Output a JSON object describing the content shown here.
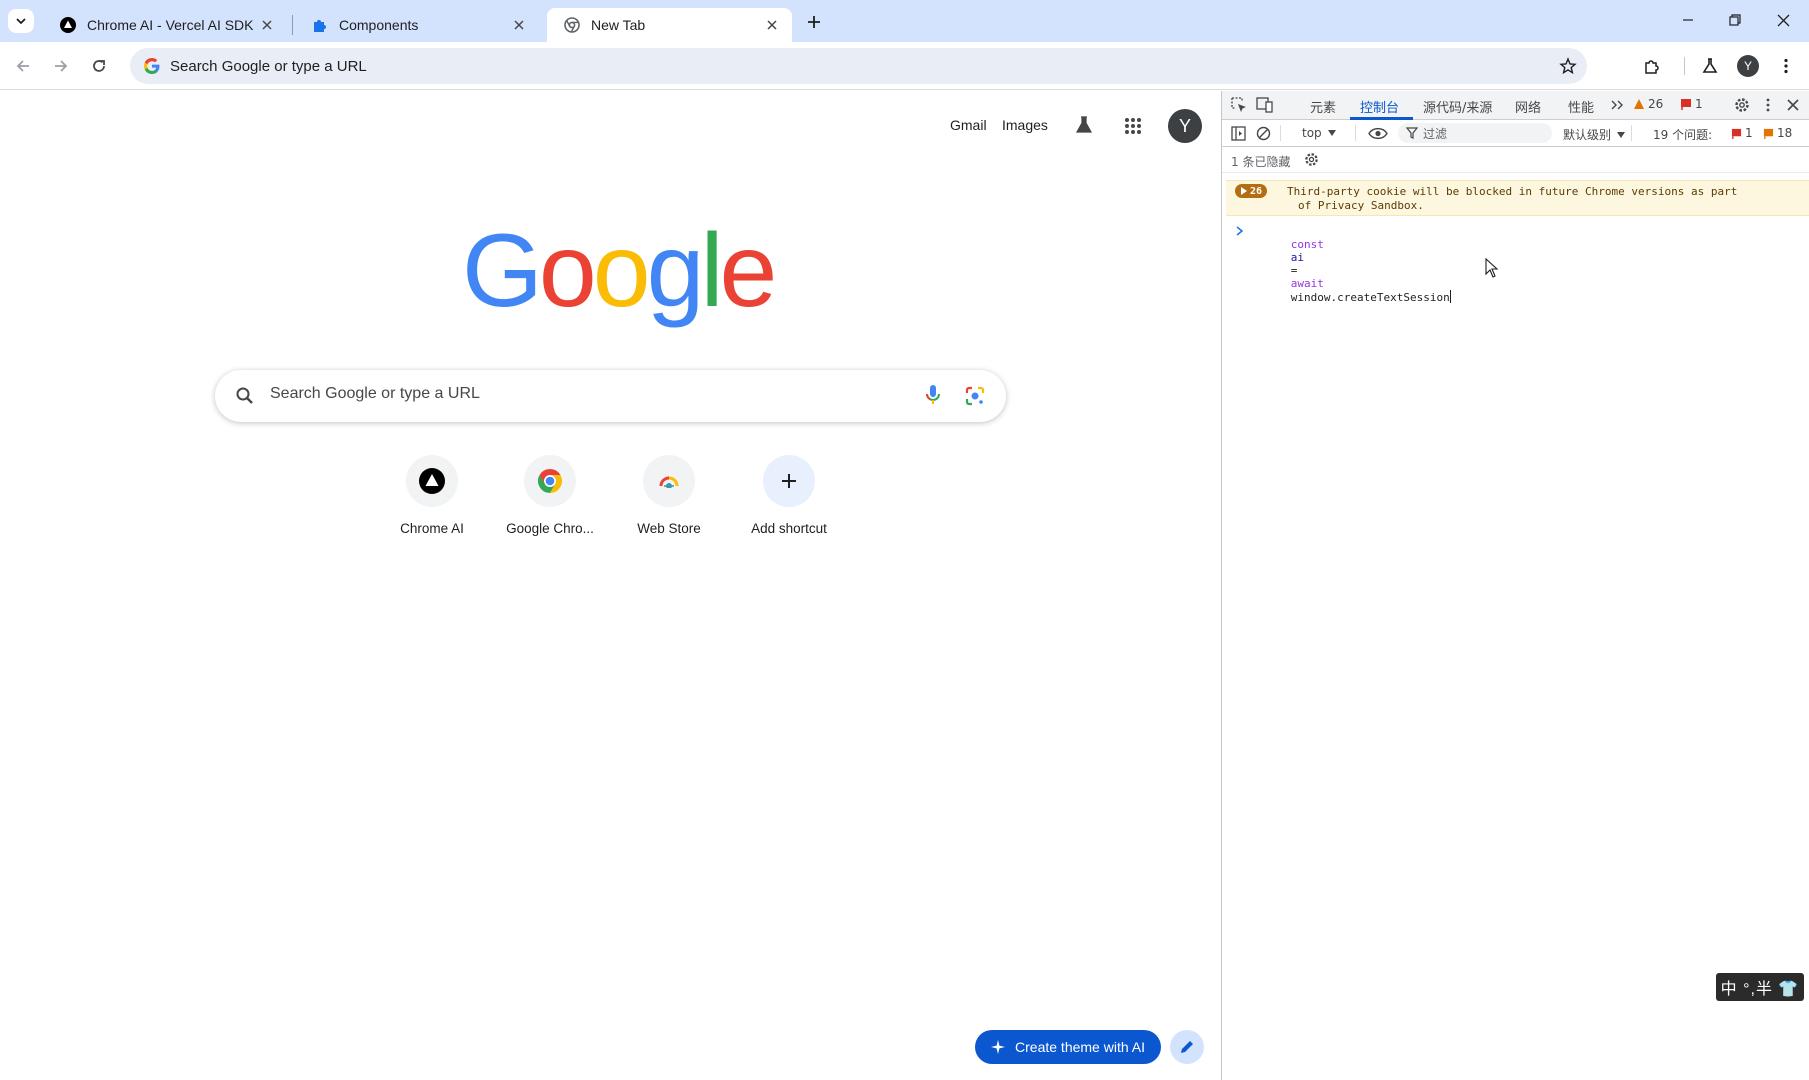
{
  "tabs": [
    {
      "title": "Chrome AI - Vercel AI SDK",
      "icon": "vercel-triangle-icon",
      "active": false
    },
    {
      "title": "Components",
      "icon": "puzzle-piece-icon",
      "active": false
    },
    {
      "title": "New Tab",
      "icon": "chrome-icon",
      "active": true
    }
  ],
  "omnibox": {
    "placeholder": "Search Google or type a URL"
  },
  "toolbar": {
    "profile_initial": "Y"
  },
  "ntp": {
    "links": {
      "gmail": "Gmail",
      "images": "Images"
    },
    "avatar_initial": "Y",
    "logo": "Google",
    "search_placeholder": "Search Google or type a URL",
    "shortcuts": [
      {
        "label": "Chrome AI",
        "icon": "vercel-triangle-icon"
      },
      {
        "label": "Google Chro...",
        "icon": "chrome-icon"
      },
      {
        "label": "Web Store",
        "icon": "web-store-icon"
      },
      {
        "label": "Add shortcut",
        "icon": "plus-icon"
      }
    ],
    "create_theme": "Create theme with AI"
  },
  "devtools": {
    "tabs": [
      "元素",
      "控制台",
      "源代码/来源",
      "网络",
      "性能"
    ],
    "active_tab": "控制台",
    "warnings_count": "26",
    "errors_count": "1",
    "context": "top",
    "filter_placeholder": "过滤",
    "level": "默认级别",
    "issues_label": "19 个问题:",
    "issues_errors": "1",
    "issues_warnings": "18",
    "hidden_label": "1 条已隐藏",
    "message": {
      "count": "26",
      "line1": "Third-party cookie will be blocked in future Chrome versions as part",
      "line2": "of Privacy Sandbox."
    },
    "input": {
      "kw_const": "const",
      "var": "ai",
      "op": "=",
      "kw_await": "await",
      "expr": "window.createTextSession"
    }
  },
  "ime": "中 °,半 👕",
  "colors": {
    "tabstrip": "#d3e3fd",
    "omnibox": "#e9eef6",
    "accent": "#0b57d0",
    "google_blue": "#4285f4",
    "google_red": "#ea4335",
    "google_yellow": "#fbbc05",
    "google_green": "#34a853"
  }
}
